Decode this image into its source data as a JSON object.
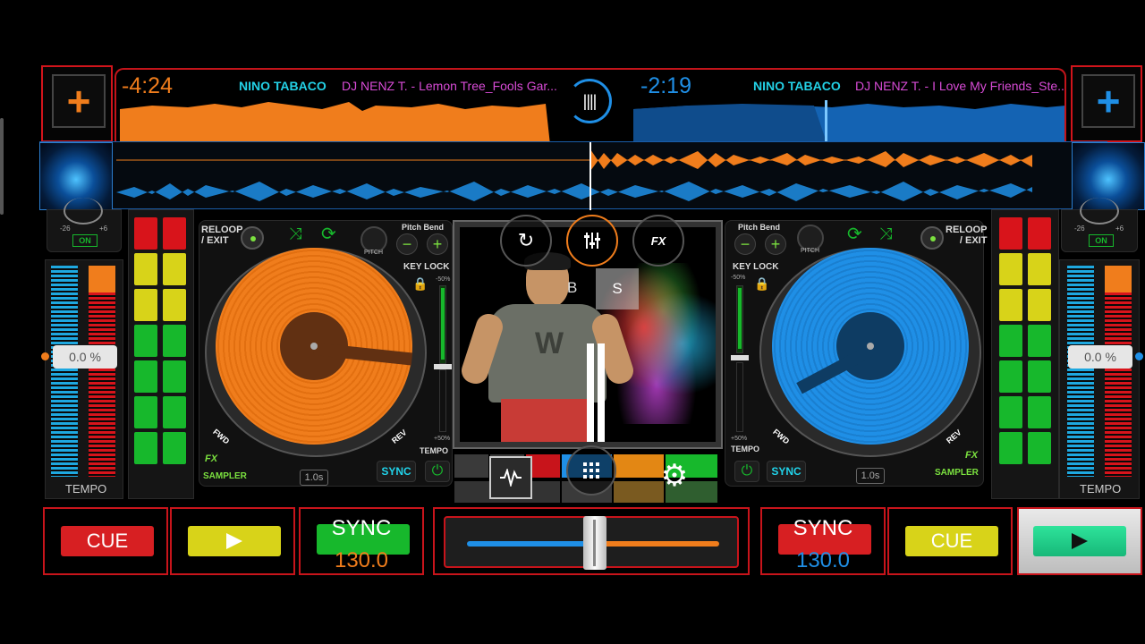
{
  "deck_a": {
    "time_remaining": "-4:24",
    "artist": "NINO TABACO",
    "title": "DJ NENZ T. - Lemon Tree_Fools Gar...",
    "tempo_value": "0.0 %",
    "tempo_label": "TEMPO",
    "reloop_label": "RELOOP\n/ EXIT",
    "pitch_bend_label": "Pitch Bend",
    "pitch_label": "PITCH",
    "key_lock_label": "KEY LOCK",
    "fx_label": "FX",
    "sampler_label": "SAMPLER",
    "fwd_label": "FWD",
    "rev_label": "REV",
    "sync_small_label": "SYNC",
    "loop_length": "1.0s",
    "pitch_top": "-50%",
    "pitch_bottom": "+50%",
    "tempo_small": "TEMPO",
    "gain_min": "-26",
    "gain_max": "+6",
    "gain_on": "ON",
    "cue_label": "CUE",
    "play_icon": "play-icon",
    "sync_label": "SYNC",
    "bpm": "130.0",
    "add_icon": "plus-icon",
    "color": "#f07d1c"
  },
  "deck_b": {
    "time_remaining": "-2:19",
    "artist": "NINO TABACO",
    "title": "DJ NENZ T. - I Love My Friends_Ste...",
    "tempo_value": "0.0 %",
    "tempo_label": "TEMPO",
    "reloop_label": "RELOOP\n/ EXIT",
    "pitch_bend_label": "Pitch Bend",
    "pitch_label": "PITCH",
    "key_lock_label": "KEY LOCK",
    "fx_label": "FX",
    "sampler_label": "SAMPLER",
    "fwd_label": "FWD",
    "rev_label": "REV",
    "sync_small_label": "SYNC",
    "loop_length": "1.0s",
    "pitch_top": "-50%",
    "pitch_bottom": "+50%",
    "tempo_small": "TEMPO",
    "gain_min": "-26",
    "gain_max": "+6",
    "gain_on": "ON",
    "cue_label": "CUE",
    "play_icon": "play-icon",
    "sync_label": "SYNC",
    "bpm": "130.0",
    "add_icon": "plus-icon",
    "color": "#1f8fe6"
  },
  "center": {
    "sync_icon": "refresh-icon",
    "mixer_icon": "mixer-sliders-icon",
    "fx_label": "FX",
    "b_label": "B",
    "s_label": "S",
    "waveform_icon": "waveform-icon",
    "grid_icon": "grid-icon",
    "settings_icon": "gear-icon",
    "crossfader_position": 0.5
  },
  "colors": {
    "accent_red": "#c8141b",
    "orange": "#f07d1c",
    "blue": "#1f8fe6",
    "cyan": "#23d1e6",
    "magenta": "#d84bd6",
    "green": "#17b82c",
    "yellow": "#d8d319"
  }
}
